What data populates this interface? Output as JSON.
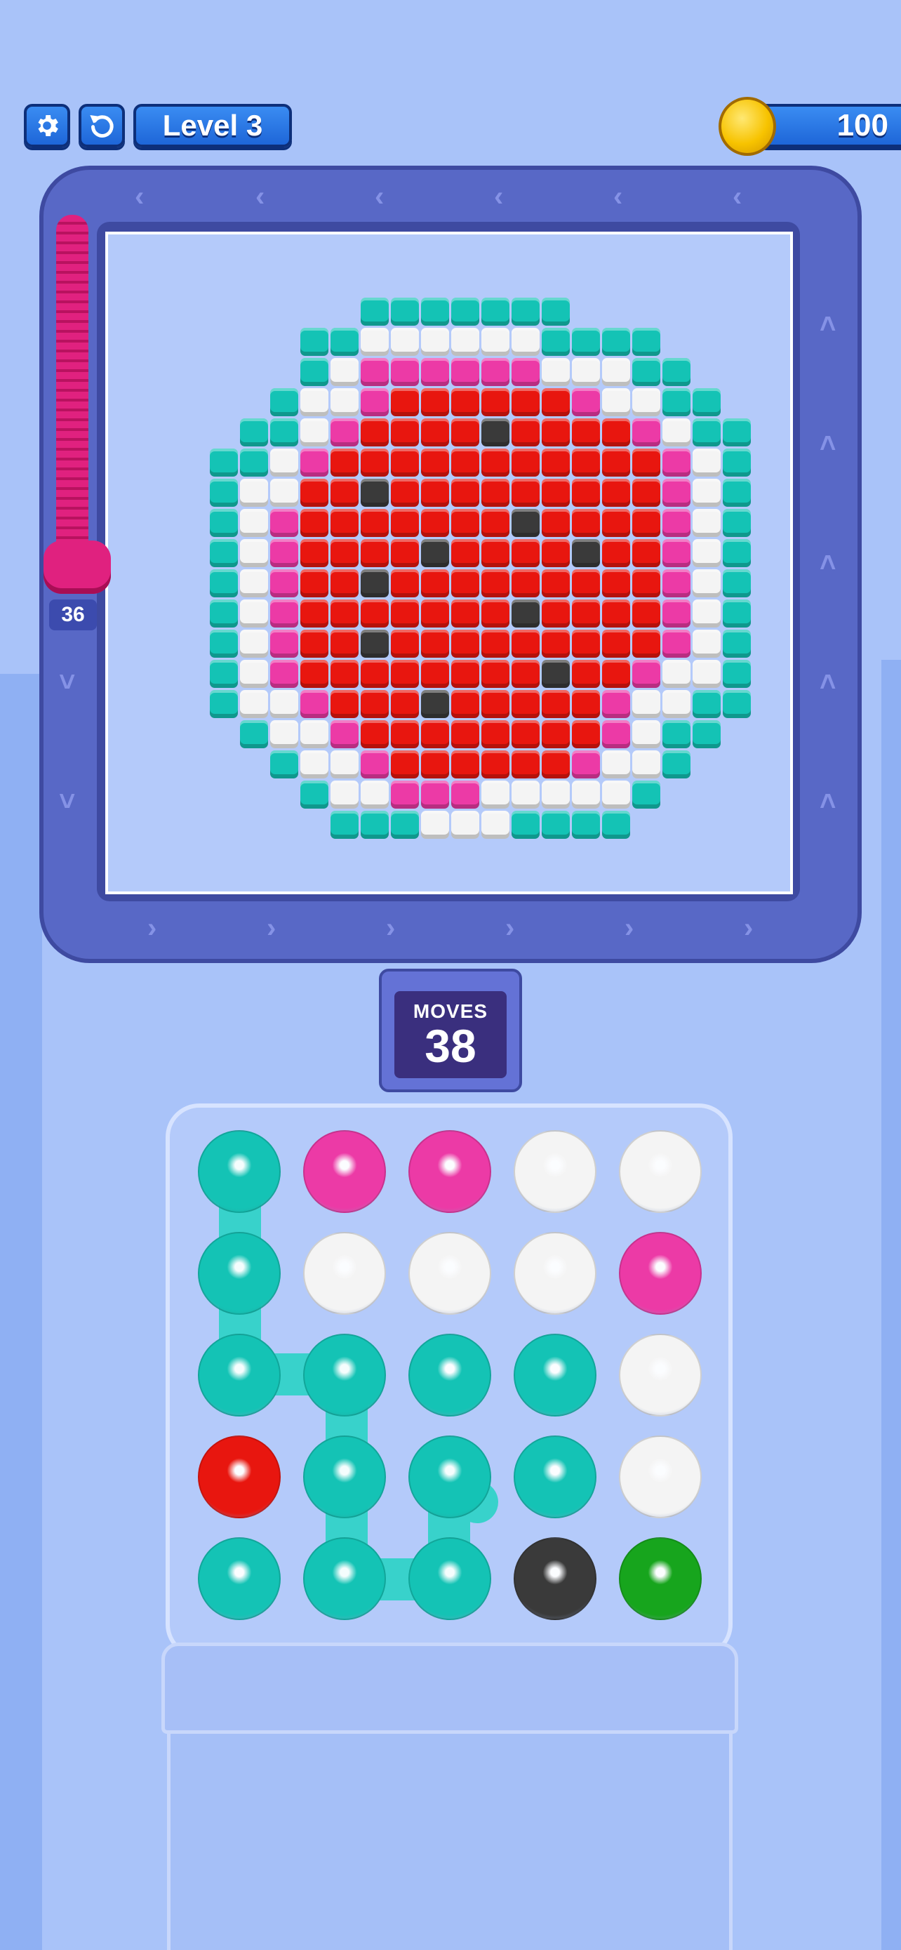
{
  "header": {
    "settings_icon": "gear-icon",
    "restart_icon": "restart-icon",
    "level_label": "Level 3",
    "coins": "100",
    "coin_icon": "coin-icon"
  },
  "shooter": {
    "count": "36",
    "color": "#e0217f"
  },
  "moves": {
    "label": "MOVES",
    "value": "38"
  },
  "colors": {
    "T": "#14c3b5",
    "W": "#f4f4f4",
    "P": "#ec3aa6",
    "R": "#e8160f",
    "K": "#3a3a3a",
    "G": "#17a51d"
  },
  "pixel_art": {
    "rows": [
      "......TTTTTTT......",
      "....TTWWWWWWTTTT...",
      "....TWPPPPPPWWWTT..",
      "...TWWPRRRRRRPWWTT.",
      "..TTWPRRRRKRRRRPWTT",
      ".TTWPRRRRRRRRRRRPWT",
      ".TWWRRKRRRRRRRRRPWT",
      ".TWPRRRRRRRKRRRRPWT",
      ".TWPRRRRKRRRRKRRPWT",
      ".TWPRRKRRRRRRRRRPWT",
      ".TWPRRRRRRRKRRRRPWT",
      ".TWPRRKRRRRRRRRRPWT",
      ".TWPRRRRRRRRKRRPWWT",
      ".TWWPRRRKRRRRRPWWTT",
      "..TWWPRRRRRRRRPWTT.",
      "...TWWPRRRRRRPWWT..",
      "....TWWPPPWWWWWT...",
      ".....TTTWWWTTTT...."
    ]
  },
  "balls": {
    "rows": [
      [
        "T",
        "P",
        "P",
        "W",
        "W"
      ],
      [
        "T",
        "W",
        "W",
        "W",
        "P"
      ],
      [
        "T",
        "T",
        "T",
        "T",
        "W"
      ],
      [
        "R",
        "T",
        "T",
        "T",
        "W"
      ],
      [
        "T",
        "T",
        "T",
        "K",
        "G"
      ]
    ]
  }
}
